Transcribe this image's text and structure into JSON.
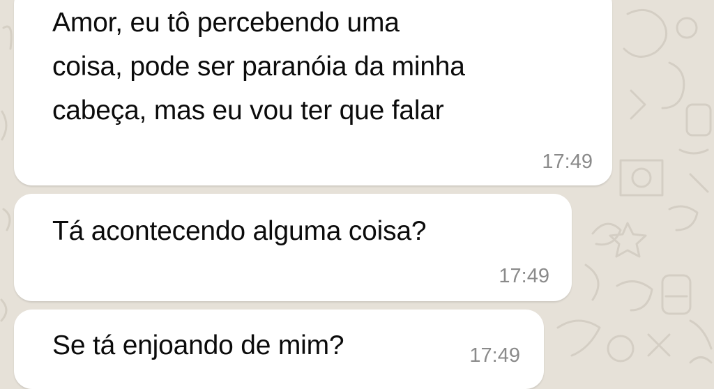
{
  "chat": {
    "messages": [
      {
        "text": "Amor, eu tô percebendo uma\ncoisa, pode ser paranóia da minha\ncabeça, mas eu vou ter que falar",
        "time": "17:49"
      },
      {
        "text": "Tá acontecendo alguma coisa?",
        "time": "17:49"
      },
      {
        "text": "Se tá enjoando de mim?",
        "time": "17:49"
      }
    ]
  },
  "colors": {
    "wallpaper": "#e6e1d8",
    "bubble": "#ffffff",
    "text": "#0b0b0b",
    "timestamp": "#8a8a8a"
  },
  "icons": [
    "doodle-wallpaper-pattern"
  ]
}
